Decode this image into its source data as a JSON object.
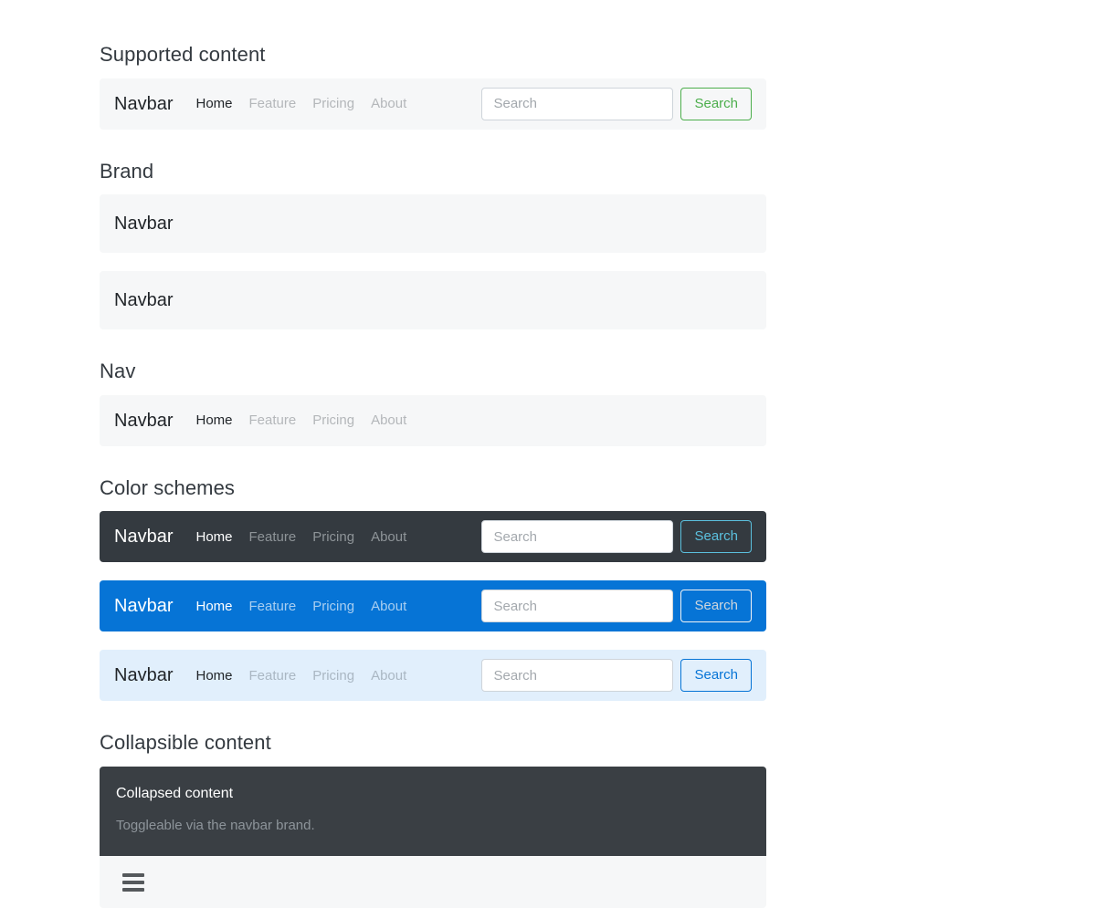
{
  "sections": {
    "supported_content": "Supported content",
    "brand": "Brand",
    "nav": "Nav",
    "color_schemes": "Color schemes",
    "collapsible_content": "Collapsible content"
  },
  "brand_label": "Navbar",
  "nav_links": [
    {
      "label": "Home",
      "active": true
    },
    {
      "label": "Feature",
      "active": false
    },
    {
      "label": "Pricing",
      "active": false
    },
    {
      "label": "About",
      "active": false
    }
  ],
  "search": {
    "placeholder": "Search",
    "value": "",
    "button_label": "Search"
  },
  "brand_bars": [
    {
      "label": "Navbar"
    },
    {
      "label": "Navbar"
    }
  ],
  "collapse": {
    "title": "Collapsed content",
    "text": "Toggleable via the navbar brand.",
    "toggler_icon": "hamburger-icon"
  },
  "colors": {
    "light_bg": "#f6f7f8",
    "dark_bg": "#343a40",
    "blue_bg": "#0674d6",
    "sky_bg": "#e1effc",
    "collapse_bg": "#3a3f44",
    "success": "#4cae4c",
    "info": "#5bc0de",
    "primary": "#0674d6",
    "light_outline": "#f1f3f5"
  }
}
